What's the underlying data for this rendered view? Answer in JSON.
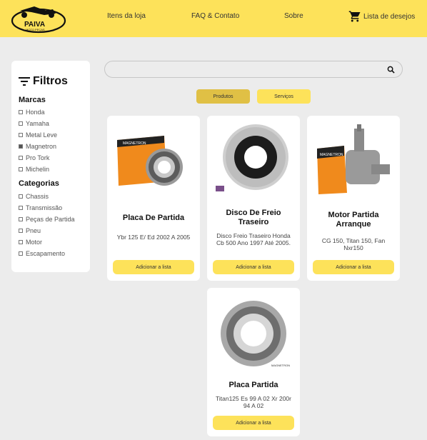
{
  "header": {
    "logo_text": "PAIVA",
    "logo_subtext": "MOTO PEÇAS",
    "nav": [
      "Itens da loja",
      "FAQ & Contato",
      "Sobre"
    ],
    "wishlist_label": "Lista de desejos",
    "wishlist_icon": "cart-icon",
    "brand_color": "#fde25a"
  },
  "filters": {
    "title": "Filtros",
    "icon": "filter-icon",
    "groups": [
      {
        "title": "Marcas",
        "options": [
          {
            "label": "Honda",
            "checked": false
          },
          {
            "label": "Yamaha",
            "checked": false
          },
          {
            "label": "Metal Leve",
            "checked": false
          },
          {
            "label": "Magnetron",
            "checked": true
          },
          {
            "label": "Pro Tork",
            "checked": false
          },
          {
            "label": "Michelin",
            "checked": false
          }
        ]
      },
      {
        "title": "Categorias",
        "options": [
          {
            "label": "Chassis",
            "checked": false
          },
          {
            "label": "Transmissão",
            "checked": false
          },
          {
            "label": "Peças de Partida",
            "checked": false
          },
          {
            "label": "Pneu",
            "checked": false
          },
          {
            "label": "Motor",
            "checked": false
          },
          {
            "label": "Escapamento",
            "checked": false
          }
        ]
      }
    ]
  },
  "search": {
    "value": "",
    "placeholder": "",
    "icon": "search-icon"
  },
  "tabs": [
    {
      "label": "Produtos",
      "active": true
    },
    {
      "label": "Serviços",
      "active": false
    }
  ],
  "products": [
    {
      "title": "Placa De Partida",
      "desc": "Ybr 125 E/ Ed 2002 A 2005",
      "button": "Adicionar a lista",
      "image_text": "MAGNETRON",
      "image": "starter-clutch-box-image"
    },
    {
      "title": "Disco De Freio Traseiro",
      "desc": "Disco Freio Traseiro Honda Cb 500 Ano 1997 Até 2005.",
      "button": "Adicionar a lista",
      "image_text": "",
      "image": "brake-disc-image"
    },
    {
      "title": "Motor Partida Arranque",
      "desc": "CG 150, Titan 150, Fan Nxr150",
      "button": "Adicionar a lista",
      "image_text": "MAGNETRON",
      "image": "starter-motor-image"
    },
    {
      "title": "Placa Partida",
      "desc": "Titan125 Es 99 A 02 Xr 200r 94 A 02",
      "button": "Adicionar a lista",
      "image_text": "MAGNETRON",
      "image": "starter-clutch-image"
    }
  ]
}
